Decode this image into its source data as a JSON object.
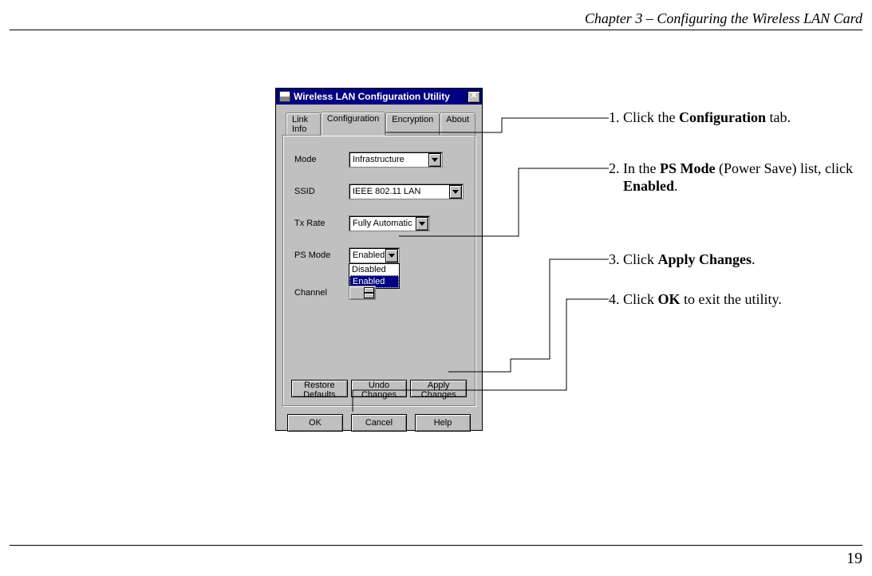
{
  "page": {
    "header": "Chapter 3 – Configuring the Wireless LAN Card",
    "number": "19"
  },
  "dialog": {
    "title": "Wireless LAN Configuration Utility",
    "close_symbol": "✕",
    "tabs": {
      "link_info": "Link Info",
      "configuration": "Configuration",
      "encryption": "Encryption",
      "about": "About"
    },
    "fields": {
      "mode_label": "Mode",
      "mode_value": "Infrastructure",
      "ssid_label": "SSID",
      "ssid_value": "IEEE 802.11 LAN",
      "txrate_label": "Tx Rate",
      "txrate_value": "Fully Automatic",
      "psmode_label": "PS Mode",
      "psmode_value": "Enabled",
      "psmode_options": {
        "disabled": "Disabled",
        "enabled": "Enabled"
      },
      "channel_label": "Channel"
    },
    "buttons": {
      "restore": "Restore Defaults",
      "undo": "Undo Changes",
      "apply": "Apply Changes",
      "ok": "OK",
      "cancel": "Cancel",
      "help": "Help"
    }
  },
  "annotations": {
    "step1_pre": "1. Click the ",
    "step1_bold": "Configuration",
    "step1_post": " tab.",
    "step2_pre": "2. In the ",
    "step2_bold": "PS Mode",
    "step2_mid": " (Power Save) list, click",
    "step2_indent": "Enabled",
    "step2_indent_post": ".",
    "step3_pre": "3. Click ",
    "step3_bold": "Apply Changes",
    "step3_post": ".",
    "step4_pre": "4. Click ",
    "step4_bold": "OK",
    "step4_post": " to exit the utility."
  }
}
